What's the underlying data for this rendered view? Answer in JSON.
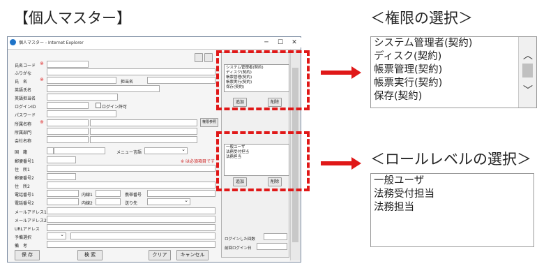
{
  "headings": {
    "main": "【個人マスター】",
    "permissions": "＜権限の選択＞",
    "roles": "＜ロールレベルの選択＞"
  },
  "window": {
    "title": "個人マスター - Internet Explorer",
    "minimize": "─",
    "maximize": "☐",
    "close": "✕"
  },
  "form": {
    "labels": {
      "name_code": "氏名コード",
      "furigana": "ふりがな",
      "name": "氏　名",
      "contact_name": "担当名",
      "english_name": "英語氏名",
      "english_contact_name": "英語担当名",
      "login_id": "ログインID",
      "password": "パスワード",
      "office_name": "所属名称",
      "department": "所属部門",
      "company_name": "会社名称",
      "country": "国　籍",
      "menu_language": "メニュー言語",
      "postal1": "郵便番号1",
      "address1": "住　所1",
      "postal2": "郵便番号2",
      "address2": "住　所2",
      "phone1": "電話番号1",
      "phone2": "電話番号2",
      "ext1": "内線1",
      "ext2": "内線2",
      "mobile": "携帯番号",
      "send_to": "送り先",
      "email1": "メールアドレス1",
      "email2": "メールアドレス2",
      "url": "URLアドレス",
      "schedule": "予備選択",
      "remarks": "備　考",
      "login_count": "ログインした回数",
      "last_login": "前回ログイン日"
    },
    "required_mark": "※",
    "required_note": "※ は必須項目です",
    "login_permit": "ログイン許可",
    "reference_button": "権限参照",
    "small_button_1": "",
    "small_button_2": ""
  },
  "permission_list": {
    "items": [
      "システム管理者(契約)",
      "ディスク(契約)",
      "帳票管理(契約)",
      "帳票実行(契約)",
      "保存(契約)"
    ],
    "add": "追加",
    "delete": "削除"
  },
  "role_list": {
    "items": [
      "一般ユーザ",
      "法務受付担当",
      "法務担当"
    ],
    "add": "追加",
    "delete": "削除"
  },
  "buttons": {
    "save": "保 存",
    "search": "検 索",
    "clear": "クリア",
    "cancel": "キャンセル"
  },
  "colors": {
    "highlight": "#e01818",
    "ie_icon": "#1e73c8"
  }
}
